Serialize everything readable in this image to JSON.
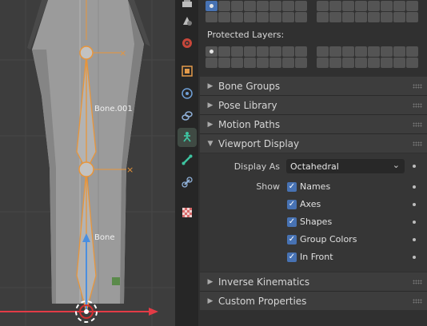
{
  "viewport": {
    "bones": [
      {
        "name": "Bone.001"
      },
      {
        "name": "Bone"
      }
    ]
  },
  "sidebar_tabs": [
    {
      "id": "output",
      "icon": "printer-icon"
    },
    {
      "id": "scene",
      "icon": "scene-icon"
    },
    {
      "id": "world",
      "icon": "world-icon"
    },
    {
      "id": "object",
      "icon": "object-icon"
    },
    {
      "id": "modifiers",
      "icon": "physics-icon"
    },
    {
      "id": "constraints",
      "icon": "constraint-icon"
    },
    {
      "id": "armature",
      "icon": "armature-icon",
      "active": true
    },
    {
      "id": "bone",
      "icon": "bone-icon"
    },
    {
      "id": "bone-constraints",
      "icon": "bone-constraint-icon"
    },
    {
      "id": "texture",
      "icon": "texture-icon"
    }
  ],
  "layers": {
    "protected_label": "Protected Layers:"
  },
  "panels": {
    "bone_groups": "Bone Groups",
    "pose_library": "Pose Library",
    "motion_paths": "Motion Paths",
    "viewport_display": "Viewport Display",
    "inverse_kinematics": "Inverse Kinematics",
    "custom_properties": "Custom Properties"
  },
  "viewport_display": {
    "display_as_label": "Display As",
    "display_as_value": "Octahedral",
    "show_label": "Show",
    "options": [
      {
        "label": "Names",
        "checked": true
      },
      {
        "label": "Axes",
        "checked": true
      },
      {
        "label": "Shapes",
        "checked": true
      },
      {
        "label": "Group Colors",
        "checked": true
      },
      {
        "label": "In Front",
        "checked": true
      }
    ]
  },
  "colors": {
    "accent": "#4772b3",
    "bone_outline": "#e8953a",
    "x_axis": "#e33b46",
    "y_axis": "#4b8fe0"
  }
}
